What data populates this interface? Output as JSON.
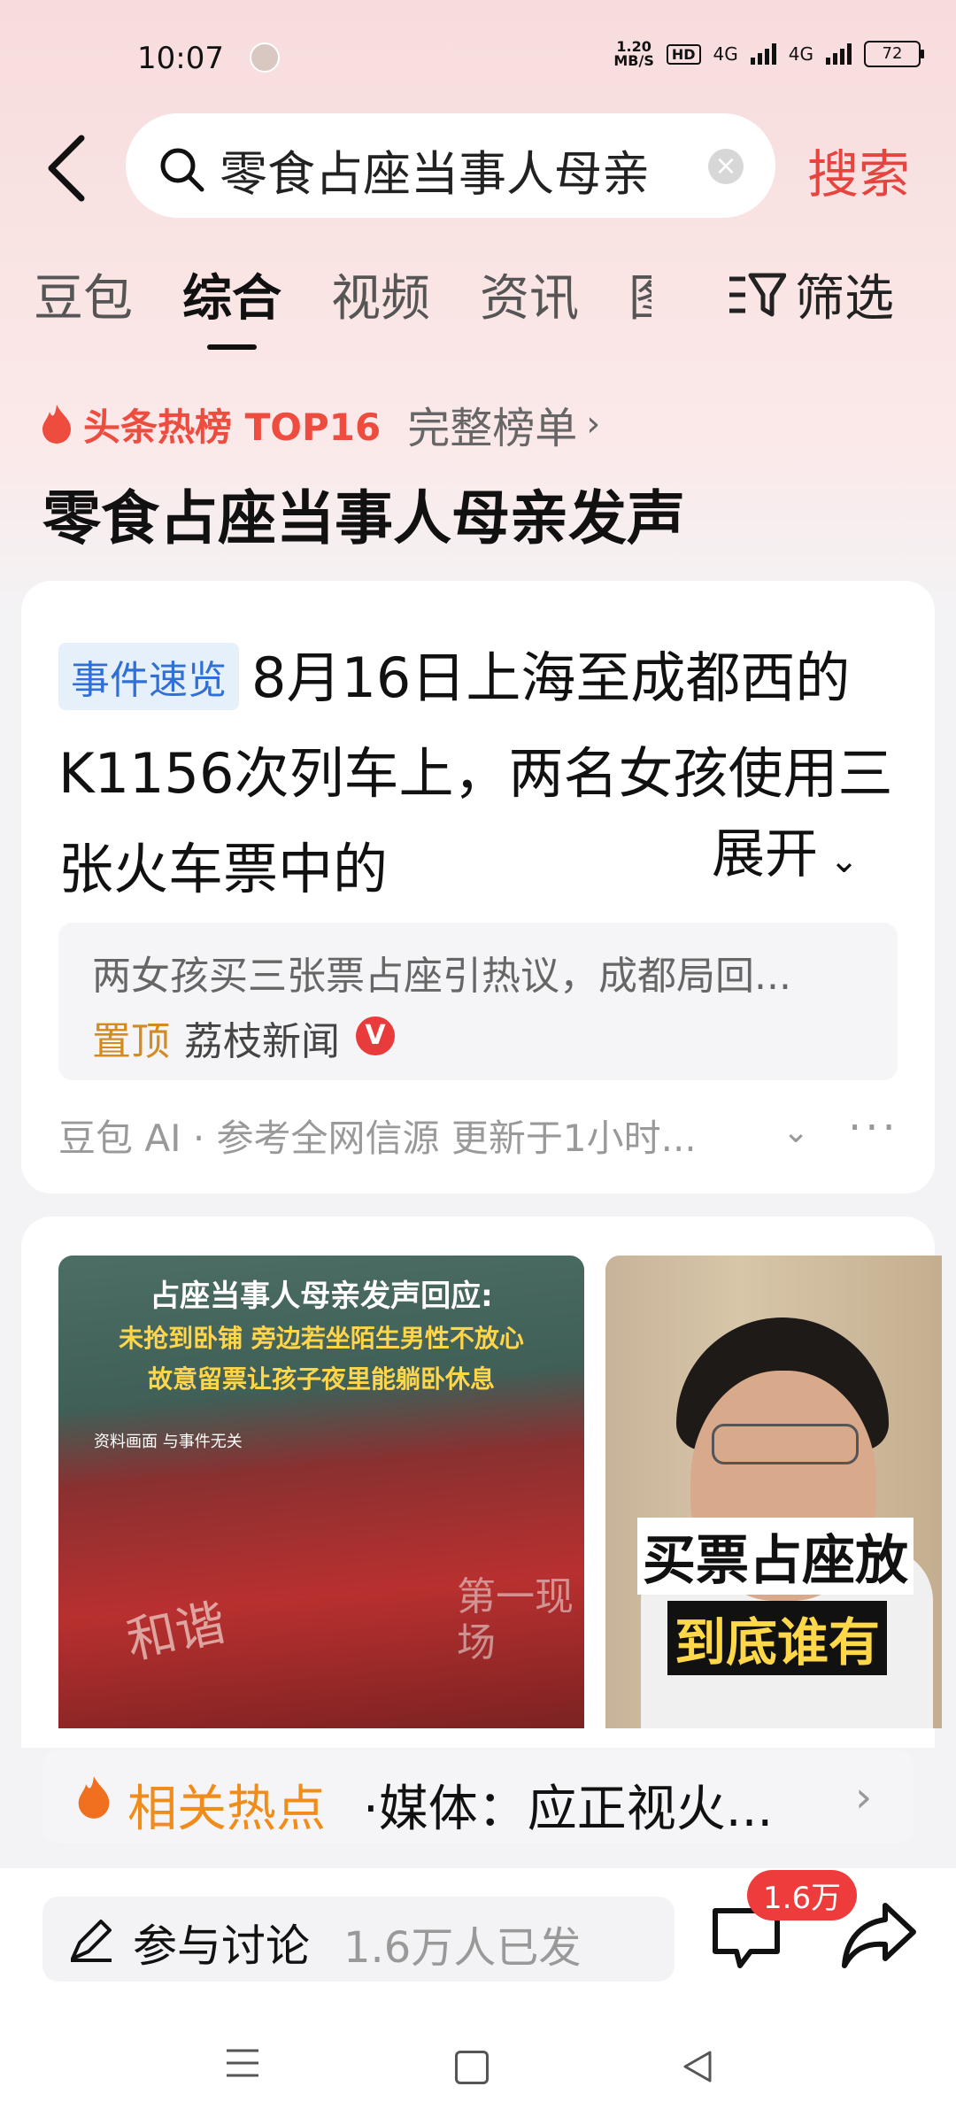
{
  "status_bar": {
    "time": "10:07",
    "net_speed_value": "1.20",
    "net_speed_unit": "MB/S",
    "hd_label": "HD",
    "signal1_label": "4G",
    "signal2_label": "4G",
    "battery": "72"
  },
  "search": {
    "back_icon": "back-arrow-icon",
    "query": "零食占座当事人母亲",
    "search_button": "搜索"
  },
  "tabs": {
    "items": [
      "豆包",
      "综合",
      "视频",
      "资讯",
      "图"
    ],
    "active": "综合",
    "filter_label": "筛选"
  },
  "hot_rank": {
    "label": "头条热榜 TOP16",
    "full_list": "完整榜单",
    "headline": "零食占座当事人母亲发声"
  },
  "summary_card": {
    "badge": "事件速览",
    "text": "8月16日上海至成都西的K1156次列车上，两名女孩使用三张火车票中的",
    "expand_label": "展开",
    "quote_text": "两女孩买三张票占座引热议，成都局回...",
    "pin_label": "置顶",
    "source": "荔枝新闻",
    "source_badge": "V",
    "ai_meta": "豆包 AI · 参考全网信源  更新于1小时..."
  },
  "media_card": {
    "image1": {
      "title": "占座当事人母亲发声回应:",
      "line1": "未抢到卧铺 旁边若坐陌生男性不放心",
      "line2": "故意留票让孩子夜里能躺卧休息",
      "note": "资料画面 与事件无关",
      "train_text": "和谐",
      "brand": "第一现场"
    },
    "image2": {
      "caption1": "买票占座放",
      "caption2": "到底谁有"
    }
  },
  "related": {
    "label": "相关热点",
    "text": "·媒体：应正视火..."
  },
  "action_bar": {
    "discuss_label": "参与讨论",
    "discuss_count": "1.6万人已发",
    "comment_badge": "1.6万"
  },
  "colors": {
    "accent_red": "#e8443f",
    "hot_orange": "#f08c1a",
    "badge_blue": "#2f6fd6"
  }
}
